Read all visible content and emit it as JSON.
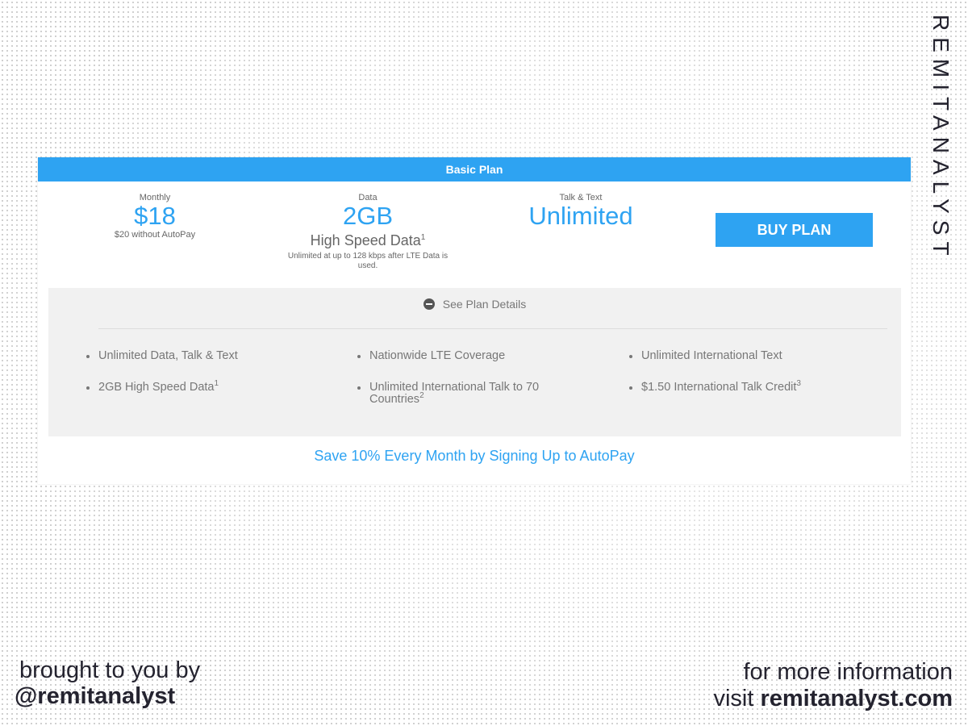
{
  "watermark": {
    "brand_vertical": "REMITANALYST",
    "brought_by": "brought to you by",
    "handle": "@remitanalyst",
    "more_info": "for more information",
    "visit": "visit",
    "website": "remitanalyst.com"
  },
  "plan": {
    "title": "Basic Plan",
    "monthly": {
      "label": "Monthly",
      "price": "$18",
      "note": "$20 without AutoPay"
    },
    "data": {
      "label": "Data",
      "amount": "2GB",
      "desc": "High Speed Data",
      "desc_sup": "1",
      "fine_print": "Unlimited at up to 128 kbps after LTE Data is used."
    },
    "talk_text": {
      "label": "Talk & Text",
      "value": "Unlimited"
    },
    "buy_label": "BUY PLAN",
    "details_toggle": "See Plan Details",
    "features": [
      {
        "text": "Unlimited Data, Talk & Text",
        "sup": ""
      },
      {
        "text": "Nationwide LTE Coverage",
        "sup": ""
      },
      {
        "text": "Unlimited International Text",
        "sup": ""
      },
      {
        "text": "2GB High Speed Data",
        "sup": "1"
      },
      {
        "text": "Unlimited International Talk to 70 Countries",
        "sup": "2"
      },
      {
        "text": "$1.50 International Talk Credit",
        "sup": "3"
      }
    ],
    "autopay_link": "Save 10% Every Month by Signing Up to AutoPay"
  },
  "colors": {
    "accent": "#2ea3f2",
    "text_gray": "#777777",
    "panel": "#f1f1f1",
    "brand_dark": "#24232f"
  }
}
